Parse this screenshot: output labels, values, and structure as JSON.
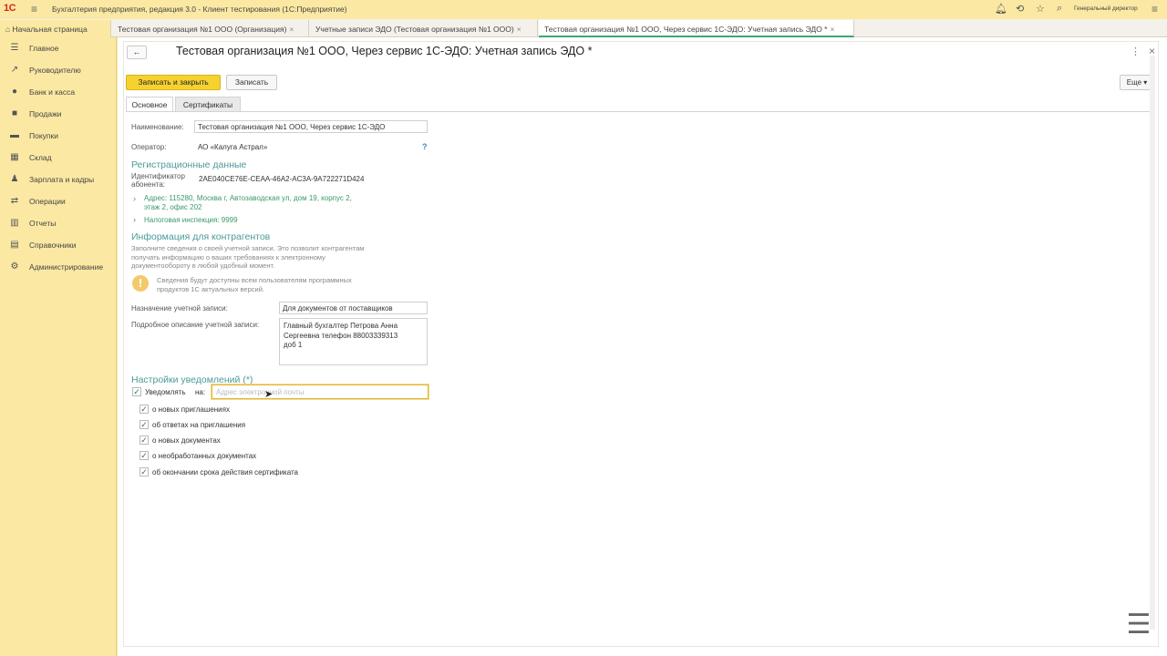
{
  "topbar": {
    "logo": "1С",
    "title": "Бухгалтерия предприятия, редакция 3.0 - Клиент тестирования (1С:Предприятие)",
    "user": "Генеральный директор",
    "icons": [
      "bell-icon",
      "history-icon",
      "star-icon",
      "search-icon",
      "menu-icon"
    ]
  },
  "tabs": [
    {
      "label": "Начальная страница"
    },
    {
      "label": "Тестовая организация №1 ООО (Организация)"
    },
    {
      "label": "Учетные записи ЭДО (Тестовая организация №1 ООО)"
    },
    {
      "label": "Тестовая организация №1 ООО, Через сервис 1С-ЭДО: Учетная запись ЭДО *"
    }
  ],
  "sidebar": {
    "items": [
      {
        "label": "Главное",
        "icon": "list-icon"
      },
      {
        "label": "Руководителю",
        "icon": "chart-line-icon"
      },
      {
        "label": "Банк и касса",
        "icon": "coins-icon"
      },
      {
        "label": "Продажи",
        "icon": "bag-icon"
      },
      {
        "label": "Покупки",
        "icon": "cart-icon"
      },
      {
        "label": "Склад",
        "icon": "warehouse-icon"
      },
      {
        "label": "Зарплата и кадры",
        "icon": "person-icon"
      },
      {
        "label": "Операции",
        "icon": "operations-icon"
      },
      {
        "label": "Отчеты",
        "icon": "bar-chart-icon"
      },
      {
        "label": "Справочники",
        "icon": "book-icon"
      },
      {
        "label": "Администрирование",
        "icon": "gear-icon"
      }
    ]
  },
  "form": {
    "title": "Тестовая организация №1 ООО, Через сервис 1С-ЭДО: Учетная запись ЭДО *",
    "buttons": {
      "save_close": "Записать и закрыть",
      "save": "Записать",
      "more": "Еще ▾"
    },
    "tabs": [
      "Основное",
      "Сертификаты"
    ],
    "name_label": "Наименование:",
    "name_value": "Тестовая организация №1 ООО, Через сервис 1С-ЭДО",
    "operator_label": "Оператор:",
    "operator_value": "АО «Калуга Астрал»",
    "help": "?",
    "reg_section": "Регистрационные данные",
    "subscriber_id_label_1": "Идентификатор",
    "subscriber_id_label_2": "абонента:",
    "subscriber_id_value": "2AE040CE76E-CEAA-46A2-AC3A-9A722271D424",
    "address_line_1": "Адрес: 115280, Москва г, Автозаводская ул, дом 19, корпус 2,",
    "address_line_2": "этаж 2, офис 202",
    "tax_office": "Налоговая инспекция: 9999",
    "contractors_section": "Информация для контрагентов",
    "contractors_hint_1": "Заполните сведения о своей учетной записи. Это позволит контрагентам",
    "contractors_hint_2": "получать информацию о ваших требованиях к электронному",
    "contractors_hint_3": "документообороту в любой удобный момент.",
    "info_note_1": "Сведения будут доступны всем пользователям программных",
    "info_note_2": "продуктов 1С актуальных версий.",
    "purpose_label": "Назначение учетной записи:",
    "purpose_value": "Для документов от поставщиков",
    "description_label": "Подробное описание учетной записи:",
    "description_line_1": "Главный бухгалтер Петрова Анна",
    "description_line_2": "Сергеевна телефон 88003339313",
    "description_line_3": "доб 1",
    "notify_section": "Настройки уведомлений (*)",
    "notify_label": "Уведомлять",
    "notify_to": "на:",
    "email_placeholder": "Адрес электронной почты",
    "checks": [
      {
        "label": "о новых приглашениях",
        "checked": true
      },
      {
        "label": "об ответах на приглашения",
        "checked": true
      },
      {
        "label": "о новых документах",
        "checked": true
      },
      {
        "label": "о необработанных документах",
        "checked": true
      },
      {
        "label": "об окончании срока действия сертификата",
        "checked": true
      }
    ]
  },
  "colors": {
    "accent_yellow": "#f6d230",
    "section_teal": "#4d9a9a",
    "link_green": "#3a9a6a",
    "sidebar_bg": "#fbe9a3"
  }
}
